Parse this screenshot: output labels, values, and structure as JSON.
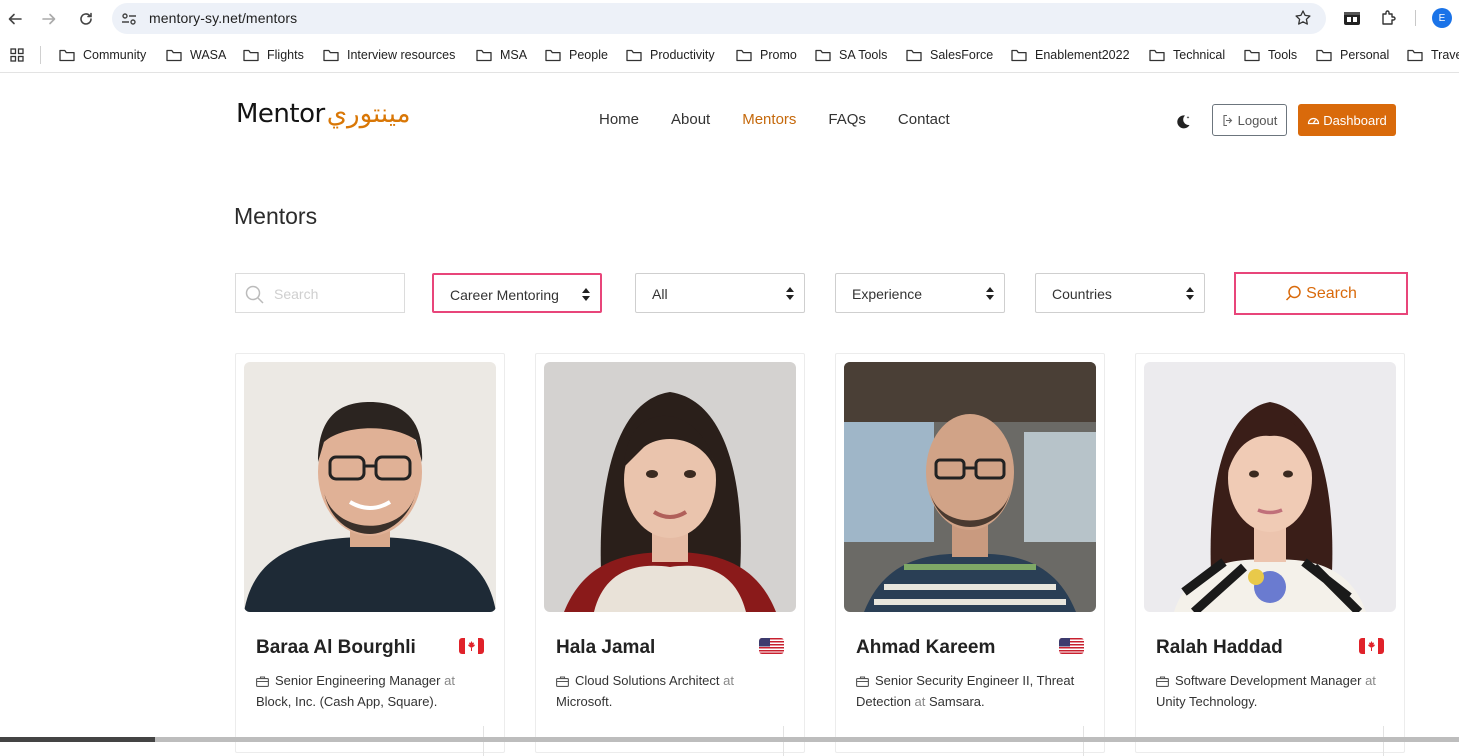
{
  "browser": {
    "url": "mentory-sy.net/mentors",
    "profile_initial": "E",
    "bookmarks": [
      "Community",
      "WASA",
      "Flights",
      "Interview resources",
      "MSA",
      "People",
      "Productivity",
      "Promo",
      "SA Tools",
      "SalesForce",
      "Enablement2022",
      "Technical",
      "Tools",
      "Personal",
      "Trave"
    ]
  },
  "site": {
    "logo_latin": "Mentor",
    "logo_arabic": "مينتوري",
    "nav": [
      "Home",
      "About",
      "Mentors",
      "FAQs",
      "Contact"
    ],
    "active_nav": "Mentors",
    "logout_label": "Logout",
    "dashboard_label": "Dashboard",
    "accent_color": "#d96a0b",
    "highlight_color": "#e8457a"
  },
  "page": {
    "title": "Mentors",
    "filters": {
      "search_placeholder": "Search",
      "mentoring_type": "Career Mentoring",
      "category": "All",
      "experience": "Experience",
      "countries": "Countries",
      "search_button": "Search"
    }
  },
  "mentors": [
    {
      "name": "Baraa Al Bourghli",
      "country": "Canada",
      "flag_icon": "canada-flag-icon",
      "role": "Senior Engineering Manager",
      "at": "at",
      "company": "Block, Inc. (Cash App, Square)."
    },
    {
      "name": "Hala Jamal",
      "country": "United States",
      "flag_icon": "us-flag-icon",
      "role": "Cloud Solutions Architect",
      "at": "at",
      "company": "Microsoft."
    },
    {
      "name": "Ahmad Kareem",
      "country": "United States",
      "flag_icon": "us-flag-icon",
      "role": "Senior Security Engineer II, Threat Detection",
      "at": "at",
      "company": "Samsara."
    },
    {
      "name": "Ralah Haddad",
      "country": "Canada",
      "flag_icon": "canada-flag-icon",
      "role": "Software Development Manager",
      "at": "at",
      "company": "Unity Technology."
    }
  ]
}
